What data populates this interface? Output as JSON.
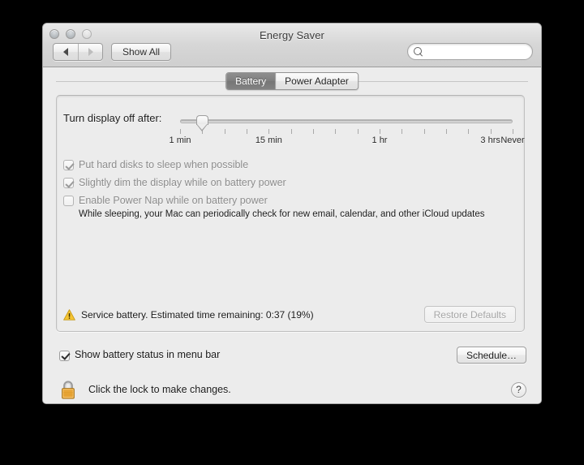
{
  "window": {
    "title": "Energy Saver",
    "traffic_lights": [
      "close",
      "minimize",
      "zoom"
    ]
  },
  "toolbar": {
    "back_label": "back-arrow",
    "forward_label": "forward-arrow",
    "show_all_label": "Show All",
    "search": {
      "value": "",
      "placeholder": ""
    }
  },
  "tabs": [
    {
      "label": "Battery",
      "active": true
    },
    {
      "label": "Power Adapter",
      "active": false
    }
  ],
  "slider": {
    "label": "Turn display off after:",
    "value_index": 1,
    "tick_count": 16,
    "tick_labels": [
      {
        "text": "1 min",
        "index": 0
      },
      {
        "text": "15 min",
        "index": 4
      },
      {
        "text": "1 hr",
        "index": 9
      },
      {
        "text": "3 hrs",
        "index": 14
      },
      {
        "text": "Never",
        "index": 15
      }
    ]
  },
  "options": [
    {
      "label": "Put hard disks to sleep when possible",
      "checked": true,
      "enabled": false
    },
    {
      "label": "Slightly dim the display while on battery power",
      "checked": true,
      "enabled": false
    },
    {
      "label": "Enable Power Nap while on battery power",
      "checked": false,
      "enabled": false
    }
  ],
  "power_nap_note": "While sleeping, your Mac can periodically check for new email, calendar, and other iCloud updates",
  "status": {
    "icon": "warning-triangle-icon",
    "text": "Service battery. Estimated time remaining: 0:37 (19%)",
    "restore_defaults_label": "Restore Defaults",
    "restore_defaults_enabled": false
  },
  "footer": {
    "show_battery_status_label": "Show battery status in menu bar",
    "show_battery_status_checked": true,
    "schedule_label": "Schedule…",
    "lock_icon": "closed-padlock-icon",
    "lock_text": "Click the lock to make changes.",
    "help_label": "?"
  },
  "colors": {
    "window_bg": "#ececec",
    "titlebar_top": "#e9e9e9",
    "titlebar_bottom": "#cfcfcf",
    "active_tab_bg": "#7e7e7e",
    "warning_yellow": "#f5c431",
    "lock_gold": "#eda93a",
    "disabled_text": "#8d8d8d",
    "text": "#1a1a1a"
  }
}
